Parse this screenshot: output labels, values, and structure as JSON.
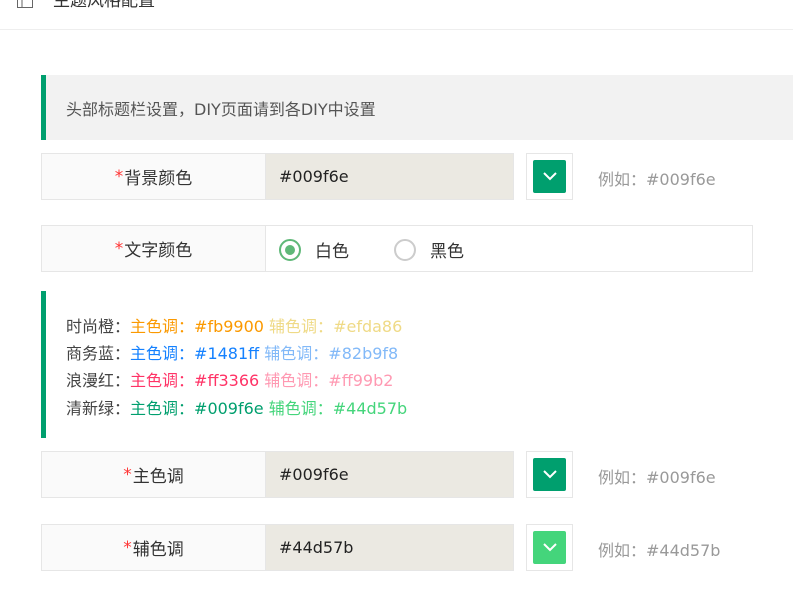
{
  "header": {
    "title": "主题风格配置"
  },
  "notice": {
    "text": "头部标题栏设置，DIY页面请到各DIY中设置"
  },
  "bg_color": {
    "label": "背景颜色",
    "value": "#009f6e",
    "swatch": "#009f6e",
    "example": "例如：#009f6e"
  },
  "text_color": {
    "label": "文字颜色",
    "options": [
      {
        "label": "白色",
        "checked": true
      },
      {
        "label": "黑色",
        "checked": false
      }
    ]
  },
  "themes": [
    {
      "name": "时尚橙：",
      "main_label": "主色调：",
      "main": "#fb9900",
      "sub_label": "辅色调：",
      "sub": "#efda86",
      "main_color": "#fb9900",
      "sub_color": "#efda86"
    },
    {
      "name": "商务蓝：",
      "main_label": "主色调：",
      "main": "#1481ff",
      "sub_label": "辅色调：",
      "sub": "#82b9f8",
      "main_color": "#1481ff",
      "sub_color": "#82b9f8"
    },
    {
      "name": "浪漫红：",
      "main_label": "主色调：",
      "main": "#ff3366",
      "sub_label": "辅色调：",
      "sub": "#ff99b2",
      "main_color": "#ff3366",
      "sub_color": "#ff99b2"
    },
    {
      "name": "清新绿：",
      "main_label": "主色调：",
      "main": "#009f6e",
      "sub_label": "辅色调：",
      "sub": "#44d57b",
      "main_color": "#009f6e",
      "sub_color": "#44d57b"
    }
  ],
  "main_color": {
    "label": "主色调",
    "value": "#009f6e",
    "swatch": "#009f6e",
    "example": "例如：#009f6e"
  },
  "sub_color": {
    "label": "辅色调",
    "value": "#44d57b",
    "swatch": "#44d57b",
    "example": "例如：#44d57b"
  }
}
